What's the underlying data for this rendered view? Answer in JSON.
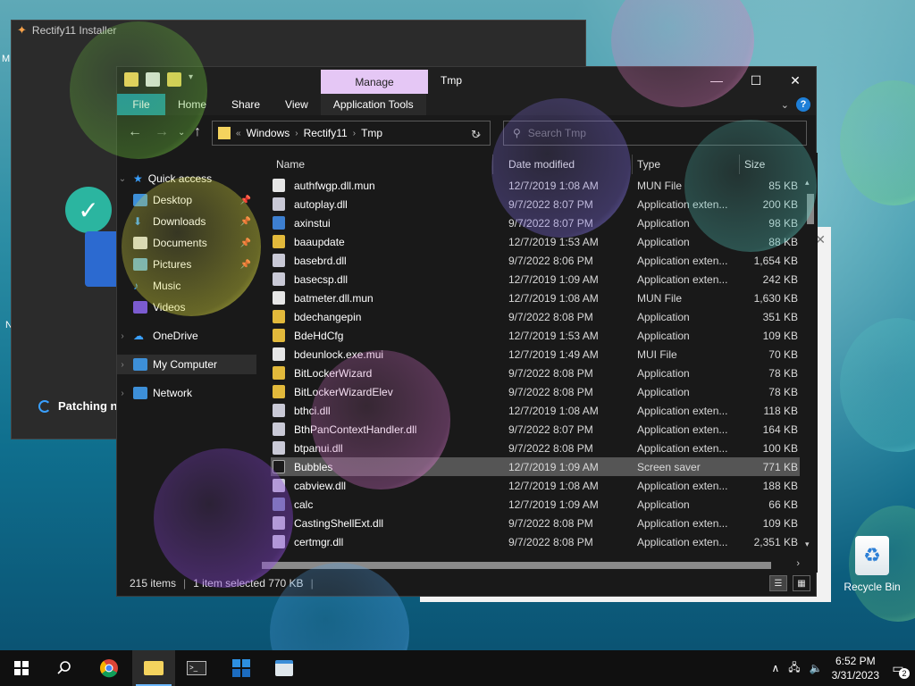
{
  "installer": {
    "title": "Rectify11 Installer",
    "status": "Patching n"
  },
  "desktop_fragments": {
    "top_left": "M",
    "mid_left": "N"
  },
  "explorer": {
    "title": "Tmp",
    "manage_tab": "Manage",
    "ribbon_tabs": [
      "File",
      "Home",
      "Share",
      "View",
      "Application Tools"
    ],
    "breadcrumb": [
      "Windows",
      "Rectify11",
      "Tmp"
    ],
    "search_placeholder": "Search Tmp",
    "nav": {
      "quick_access": "Quick access",
      "desktop": "Desktop",
      "downloads": "Downloads",
      "documents": "Documents",
      "pictures": "Pictures",
      "music": "Music",
      "videos": "Videos",
      "onedrive": "OneDrive",
      "my_computer": "My Computer",
      "network": "Network"
    },
    "columns": {
      "name": "Name",
      "date": "Date modified",
      "type": "Type",
      "size": "Size"
    },
    "files": [
      {
        "name": "authfwgp.dll.mun",
        "date": "12/7/2019 1:08 AM",
        "type": "MUN File",
        "size": "85 KB",
        "color": "#e6e6e6"
      },
      {
        "name": "autoplay.dll",
        "date": "9/7/2022 8:07 PM",
        "type": "Application exten...",
        "size": "200 KB",
        "color": "#c9c9d6"
      },
      {
        "name": "axinstui",
        "date": "9/7/2022 8:07 PM",
        "type": "Application",
        "size": "98 KB",
        "color": "#3d7fd0"
      },
      {
        "name": "baaupdate",
        "date": "12/7/2019 1:53 AM",
        "type": "Application",
        "size": "88 KB",
        "color": "#e2b93b"
      },
      {
        "name": "basebrd.dll",
        "date": "9/7/2022 8:06 PM",
        "type": "Application exten...",
        "size": "1,654 KB",
        "color": "#c9c9d6"
      },
      {
        "name": "basecsp.dll",
        "date": "12/7/2019 1:09 AM",
        "type": "Application exten...",
        "size": "242 KB",
        "color": "#c9c9d6"
      },
      {
        "name": "batmeter.dll.mun",
        "date": "12/7/2019 1:08 AM",
        "type": "MUN File",
        "size": "1,630 KB",
        "color": "#e6e6e6"
      },
      {
        "name": "bdechangepin",
        "date": "9/7/2022 8:08 PM",
        "type": "Application",
        "size": "351 KB",
        "color": "#e2b93b"
      },
      {
        "name": "BdeHdCfg",
        "date": "12/7/2019 1:53 AM",
        "type": "Application",
        "size": "109 KB",
        "color": "#e2b93b"
      },
      {
        "name": "bdeunlock.exe.mui",
        "date": "12/7/2019 1:49 AM",
        "type": "MUI File",
        "size": "70 KB",
        "color": "#e6e6e6"
      },
      {
        "name": "BitLockerWizard",
        "date": "9/7/2022 8:08 PM",
        "type": "Application",
        "size": "78 KB",
        "color": "#e2b93b"
      },
      {
        "name": "BitLockerWizardElev",
        "date": "9/7/2022 8:08 PM",
        "type": "Application",
        "size": "78 KB",
        "color": "#e2b93b"
      },
      {
        "name": "bthci.dll",
        "date": "12/7/2019 1:08 AM",
        "type": "Application exten...",
        "size": "118 KB",
        "color": "#c9c9d6"
      },
      {
        "name": "BthPanContextHandler.dll",
        "date": "9/7/2022 8:07 PM",
        "type": "Application exten...",
        "size": "164 KB",
        "color": "#c9c9d6"
      },
      {
        "name": "btpanui.dll",
        "date": "9/7/2022 8:08 PM",
        "type": "Application exten...",
        "size": "100 KB",
        "color": "#c9c9d6"
      },
      {
        "name": "Bubbles",
        "date": "12/7/2019 1:09 AM",
        "type": "Screen saver",
        "size": "771 KB",
        "color": "#1a1a1a",
        "selected": true
      },
      {
        "name": "cabview.dll",
        "date": "12/7/2019 1:08 AM",
        "type": "Application exten...",
        "size": "188 KB",
        "color": "#c9c9d6"
      },
      {
        "name": "calc",
        "date": "12/7/2019 1:09 AM",
        "type": "Application",
        "size": "66 KB",
        "color": "#7a8ab0"
      },
      {
        "name": "CastingShellExt.dll",
        "date": "9/7/2022 8:08 PM",
        "type": "Application exten...",
        "size": "109 KB",
        "color": "#c9c9d6"
      },
      {
        "name": "certmgr.dll",
        "date": "9/7/2022 8:08 PM",
        "type": "Application exten...",
        "size": "2,351 KB",
        "color": "#c9c9d6"
      }
    ],
    "status": {
      "count": "215 items",
      "selected": "1 item selected  770 KB"
    }
  },
  "recycle_bin": "Recycle Bin",
  "taskbar": {
    "time": "6:52 PM",
    "date": "3/31/2023",
    "notification_count": "2"
  },
  "colors": {
    "accent": "#1b8fa3",
    "manage_tab": "#e5c7f5",
    "folder": "#f4d35e"
  }
}
